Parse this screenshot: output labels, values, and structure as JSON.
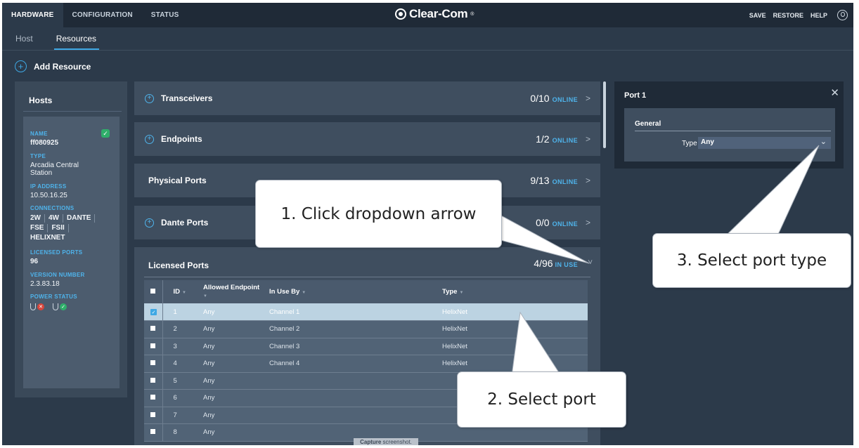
{
  "topbar": {
    "tabs": [
      "HARDWARE",
      "CONFIGURATION",
      "STATUS"
    ],
    "brand": "Clear-Com",
    "brand_mark": "®",
    "actions": [
      "SAVE",
      "RESTORE",
      "HELP"
    ]
  },
  "subtabs": [
    "Host",
    "Resources"
  ],
  "add_resource": {
    "label": "Add Resource"
  },
  "hosts": {
    "title": "Hosts",
    "card": {
      "name_label": "NAME",
      "name": "ff080925",
      "type_label": "TYPE",
      "type": "Arcadia Central Station",
      "ip_label": "IP ADDRESS",
      "ip": "10.50.16.25",
      "connections_label": "CONNECTIONS",
      "connections": [
        "2W",
        "4W",
        "DANTE",
        "FSE",
        "FSII",
        "HELIXNET"
      ],
      "licensed_label": "LICENSED PORTS",
      "licensed": "96",
      "version_label": "VERSION NUMBER",
      "version": "2.3.83.18",
      "power_label": "POWER STATUS"
    }
  },
  "resources": [
    {
      "name": "Transceivers",
      "count": "0/10",
      "status": "ONLINE",
      "has_plus": true
    },
    {
      "name": "Endpoints",
      "count": "1/2",
      "status": "ONLINE",
      "has_plus": true
    },
    {
      "name": "Physical Ports",
      "count": "9/13",
      "status": "ONLINE",
      "has_plus": false
    },
    {
      "name": "Dante Ports",
      "count": "0/0",
      "status": "ONLINE",
      "has_plus": true
    }
  ],
  "licensed_ports": {
    "title": "Licensed Ports",
    "count": "4/96",
    "status": "IN USE",
    "columns": [
      "ID",
      "Allowed Endpoint",
      "In Use By",
      "Type"
    ],
    "rows": [
      {
        "id": "1",
        "endpoint": "Any",
        "in_use_by": "Channel 1",
        "type": "HelixNet",
        "selected": true
      },
      {
        "id": "2",
        "endpoint": "Any",
        "in_use_by": "Channel 2",
        "type": "HelixNet",
        "selected": false
      },
      {
        "id": "3",
        "endpoint": "Any",
        "in_use_by": "Channel 3",
        "type": "HelixNet",
        "selected": false
      },
      {
        "id": "4",
        "endpoint": "Any",
        "in_use_by": "Channel 4",
        "type": "HelixNet",
        "selected": false
      },
      {
        "id": "5",
        "endpoint": "Any",
        "in_use_by": "",
        "type": "",
        "selected": false
      },
      {
        "id": "6",
        "endpoint": "Any",
        "in_use_by": "",
        "type": "",
        "selected": false
      },
      {
        "id": "7",
        "endpoint": "Any",
        "in_use_by": "",
        "type": "",
        "selected": false
      },
      {
        "id": "8",
        "endpoint": "Any",
        "in_use_by": "",
        "type": "",
        "selected": false
      }
    ]
  },
  "port_panel": {
    "title": "Port 1",
    "section": "General",
    "type_label": "Type",
    "type_value": "Any"
  },
  "capture": {
    "bold": "Capture",
    "rest": " screenshot."
  },
  "callouts": {
    "step1": "1. Click dropdown arrow",
    "step2": "2. Select port",
    "step3": "3. Select port type"
  },
  "colors": {
    "background": "#2c3a4a",
    "topbar": "#1f2a37",
    "accent": "#3ea8e4",
    "online_ok": "#2fae6a",
    "power_fault": "#d8453b"
  }
}
